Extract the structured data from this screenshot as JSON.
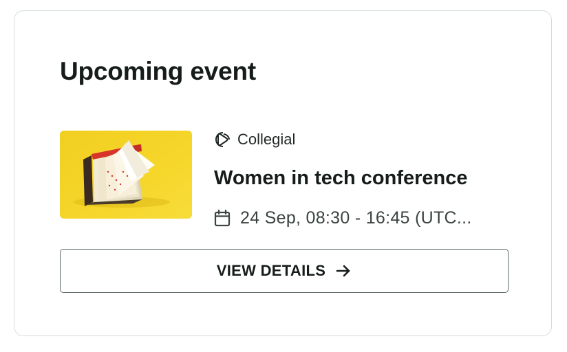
{
  "card": {
    "title": "Upcoming event"
  },
  "event": {
    "organizer": "Collegial",
    "organizer_icon": "collegial-logo-icon",
    "name": "Women in tech conference",
    "date_icon": "calendar-icon",
    "datetime": "24 Sep, 08:30 - 16:45 (UTC...",
    "thumbnail": "event-thumbnail-image"
  },
  "actions": {
    "view_details_label": "VIEW DETAILS",
    "view_details_icon": "arrow-right-icon"
  },
  "colors": {
    "border": "#d4dcdb",
    "text": "#151c1a",
    "thumbnail_bg": "#f3d21e"
  }
}
